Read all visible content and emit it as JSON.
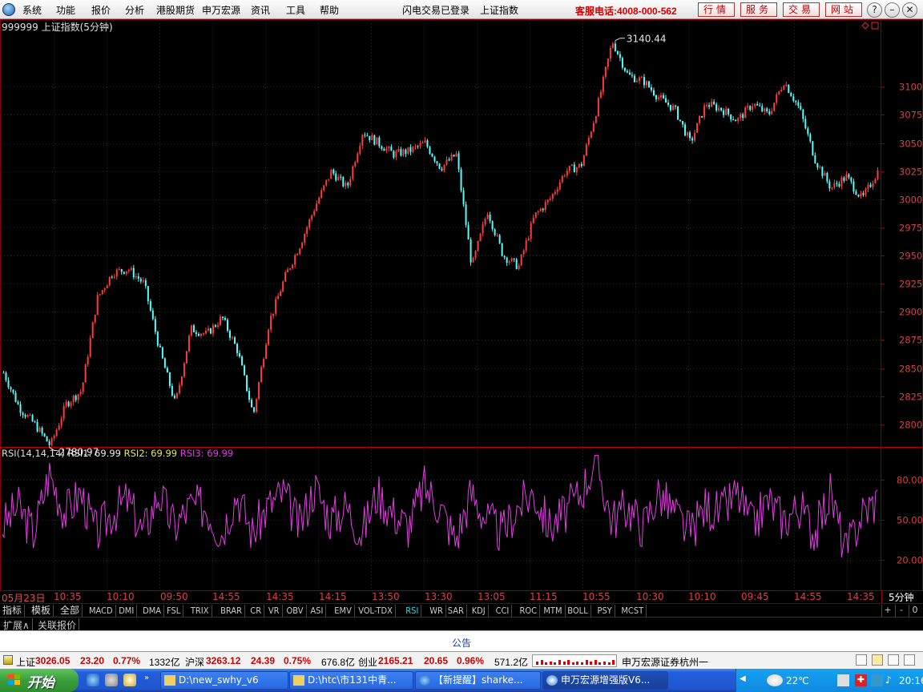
{
  "menu": {
    "items": [
      "系统",
      "功能",
      "报价",
      "分析",
      "港股期货",
      "申万宏源",
      "资讯",
      "工具",
      "帮助"
    ],
    "status": "闪电交易已登录",
    "current": "上证指数",
    "phone": "客服电话:4008-000-562",
    "buttons": [
      "行情",
      "服务",
      "交易",
      "网站"
    ]
  },
  "chart": {
    "title": "999999 上证指数(5分钟)",
    "high_label": "3140.44",
    "low_label": "2780.97",
    "price_axis": [
      "3100",
      "3075",
      "3050",
      "3025",
      "3000",
      "2975",
      "2950",
      "2925",
      "2900",
      "2875",
      "2850",
      "2825",
      "2800"
    ],
    "rsi_header": {
      "name": "RSI(14,14,14)",
      "rsi1": "RSI1: 69.99",
      "rsi2": "RSI2: 69.99",
      "rsi3": "RSI3: 69.99"
    },
    "rsi_axis": [
      "80.00",
      "50.00",
      "20.00"
    ],
    "time_axis": [
      "05月23日",
      "10:35",
      "10:10",
      "09:50",
      "14:55",
      "14:35",
      "14:15",
      "13:50",
      "13:30",
      "13:05",
      "11:15",
      "10:55",
      "10:30",
      "10:10",
      "09:45",
      "14:55",
      "14:35"
    ],
    "period": "5分钟",
    "colors": {
      "up": "#ff3b3b",
      "down": "#54ffff",
      "grid": "#8a0000",
      "rsi": "#e43ce4"
    }
  },
  "chart_data": {
    "type": "line",
    "title": "999999 上证指数(5分钟)",
    "annotations": {
      "high": 3140.44,
      "low": 2780.97
    },
    "ylim": [
      2780,
      3150
    ],
    "x": [
      "05月23日",
      "10:35",
      "10:10",
      "09:50",
      "14:55",
      "14:35",
      "14:15",
      "13:50",
      "13:30",
      "13:05",
      "11:15",
      "10:55",
      "10:30",
      "10:10",
      "09:45",
      "14:55",
      "14:35"
    ],
    "series": [
      {
        "values": [
          2846,
          2815,
          2800,
          2781,
          2818,
          2830,
          2912,
          2935,
          2938,
          2925,
          2866,
          2818,
          2885,
          2880,
          2895,
          2865,
          2808,
          2890,
          2930,
          2960,
          2995,
          3025,
          3010,
          3060,
          3050,
          3040,
          3043,
          3050,
          3028,
          3040,
          2940,
          2990,
          2950,
          2940,
          2985,
          3000,
          3025,
          3030,
          3080,
          3140.44,
          3110,
          3105,
          3090,
          3080,
          3050,
          3085,
          3080,
          3070,
          3085,
          3075,
          3105,
          3080,
          3035,
          3010,
          3020,
          3000,
          3025
        ]
      },
      {
        "values": [
          45,
          60,
          40,
          85,
          55,
          70,
          40,
          55,
          65,
          40,
          70,
          45,
          60,
          60,
          40,
          70,
          40,
          60,
          70,
          45,
          75,
          50,
          60,
          40,
          70,
          55,
          45,
          75,
          60,
          35,
          70,
          50,
          40,
          60,
          70,
          45,
          55,
          70,
          95,
          50,
          60,
          45,
          70,
          55,
          40,
          60,
          55,
          70,
          45,
          65,
          50,
          60,
          40,
          70,
          25,
          55,
          65
        ]
      }
    ],
    "rsi_levels": {
      "rsi1": 69.99,
      "rsi2": 69.99,
      "rsi3": 69.99
    },
    "rsi_ylim": [
      0,
      100
    ]
  },
  "tabs": [
    "指标",
    "模板",
    "全部",
    "MACD",
    "DMI",
    "DMA",
    "FSL",
    "TRIX",
    "BRAR",
    "CR",
    "VR",
    "OBV",
    "ASI",
    "EMV",
    "VOL-TDX",
    "RSI",
    "WR",
    "SAR",
    "KDJ",
    "CCI",
    "ROC",
    "MTM",
    "BOLL",
    "PSY",
    "MCST"
  ],
  "active_tab": "RSI",
  "tab_controls": [
    "+",
    "-",
    "0"
  ],
  "ext_tabs": [
    "扩展∧",
    "关联报价"
  ],
  "notice": "公告",
  "ticker": {
    "sh_label": "上证",
    "sh_price": "3026.05",
    "sh_chg": "23.20",
    "sh_pct": "0.77%",
    "sh_amt": "1332亿",
    "hs_label": "沪深",
    "hs_price": "3263.12",
    "hs_chg": "24.39",
    "hs_pct": "0.75%",
    "hs_amt": "676.8亿",
    "cy_label": "创业",
    "cy_price": "2165.21",
    "cy_chg": "20.65",
    "cy_pct": "0.96%",
    "cy_amt": "571.2亿",
    "broker": "申万宏源证券杭州一"
  },
  "taskbar": {
    "start": "开始",
    "windows": [
      "D:\\new_swhy_v6",
      "D:\\htc\\市131中青...",
      "【新提醒】sharke...",
      "申万宏源增强版V6..."
    ],
    "temp": "22℃",
    "clock": "20:16"
  }
}
